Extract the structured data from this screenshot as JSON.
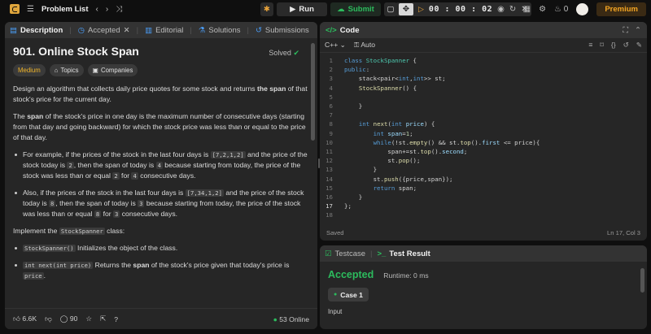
{
  "topbar": {
    "problem_list": "Problem List",
    "run": "Run",
    "submit": "Submit",
    "timer": "00 : 00 : 02",
    "streak_count": "0",
    "premium": "Premium"
  },
  "left": {
    "tabs": [
      "Description",
      "Accepted",
      "Editorial",
      "Solutions",
      "Submissions"
    ],
    "title": "901. Online Stock Span",
    "solved": "Solved",
    "chips": [
      "Medium",
      "Topics",
      "Companies"
    ],
    "p1a": "Design an algorithm that collects daily price quotes for some stock and returns ",
    "p1b": "the span",
    "p1c": " of that stock's price for the current day.",
    "p2a": "The ",
    "p2b": "span",
    "p2c": " of the stock's price in one day is the maximum number of consecutive days (starting from that day and going backward) for which the stock price was less than or equal to the price of that day.",
    "b1a": "For example, if the prices of the stock in the last four days is ",
    "b1c1": "[7,2,1,2]",
    "b1b": " and the price of the stock today is ",
    "b1c2": "2",
    "b1d": ", then the span of today is ",
    "b1c3": "4",
    "b1e": " because starting from today, the price of the stock was less than or equal ",
    "b1c4": "2",
    "b1f": " for ",
    "b1c5": "4",
    "b1g": " consecutive days.",
    "b2a": "Also, if the prices of the stock in the last four days is ",
    "b2c1": "[7,34,1,2]",
    "b2b": " and the price of the stock today is ",
    "b2c2": "8",
    "b2d": ", then the span of today is ",
    "b2c3": "3",
    "b2e": " because starting from today, the price of the stock was less than or equal ",
    "b2c4": "8",
    "b2f": " for ",
    "b2c5": "3",
    "b2g": " consecutive days.",
    "impl_a": "Implement the ",
    "impl_code": "StockSpanner",
    "impl_b": " class:",
    "m1_code": "StockSpanner()",
    "m1_text": " Initializes the object of the class.",
    "m2_code": "int next(int price)",
    "m2_a": " Returns the ",
    "m2_b": "span",
    "m2_c": " of the stock's price given that today's price is ",
    "m2_code2": "price",
    "m2_d": ".",
    "likes": "6.6K",
    "comments": "90",
    "online": "53 Online"
  },
  "editor": {
    "title": "Code",
    "language": "C++",
    "mode": "Auto",
    "status_left": "Saved",
    "status_right": "Ln 17, Col 3"
  },
  "bottom": {
    "tabs": [
      "Testcase",
      "Test Result"
    ],
    "result": "Accepted",
    "runtime": "Runtime: 0 ms",
    "case": "Case 1",
    "input_label": "Input"
  },
  "colors": {
    "accent_green": "#2cbb5d",
    "premium": "#f5a623",
    "medium": "#f0b429"
  }
}
